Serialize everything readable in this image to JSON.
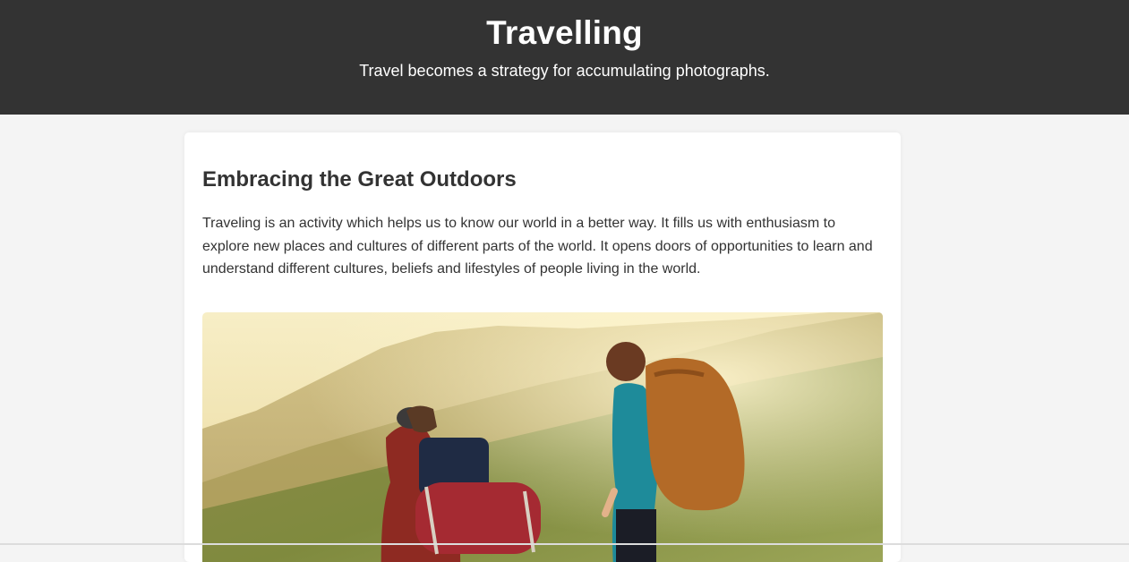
{
  "header": {
    "title": "Travelling",
    "tagline": "Travel becomes a strategy for accumulating photographs."
  },
  "article": {
    "heading": "Embracing the Great Outdoors",
    "paragraph": "Traveling is an activity which helps us to know our world in a better way. It fills us with enthusiasm to explore new places and cultures of different parts of the world. It opens doors of opportunities to learn and understand different cultures, beliefs and lifestyles of people living in the world."
  },
  "colors": {
    "header_bg": "#333333",
    "page_bg": "#f4f4f4",
    "card_bg": "#ffffff",
    "text": "#333333"
  }
}
